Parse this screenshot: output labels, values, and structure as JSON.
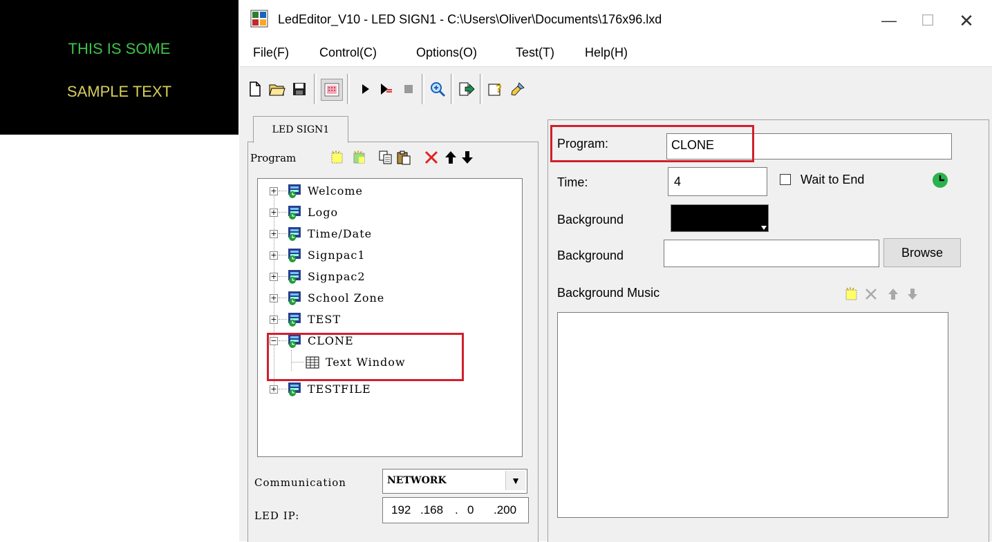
{
  "preview": {
    "line1": "THIS IS SOME",
    "line2": "SAMPLE TEXT"
  },
  "window": {
    "title": "LedEditor_V10 - LED SIGN1 - C:\\Users\\Oliver\\Documents\\176x96.lxd",
    "minimize_glyph": "—",
    "maximize_glyph": "☐",
    "close_glyph": "✕"
  },
  "menu": [
    "File(F)",
    "Control(C)",
    "Options(O)",
    "Test(T)",
    "Help(H)"
  ],
  "tab": {
    "label": "LED SIGN1"
  },
  "program_toolbar": {
    "label": "Program"
  },
  "tree": {
    "items": [
      {
        "label": "Welcome",
        "expander": "+"
      },
      {
        "label": "Logo",
        "expander": "+"
      },
      {
        "label": "Time/Date",
        "expander": "+"
      },
      {
        "label": "Signpac1",
        "expander": "+"
      },
      {
        "label": "Signpac2",
        "expander": "+"
      },
      {
        "label": "School Zone",
        "expander": "+"
      },
      {
        "label": "TEST",
        "expander": "+"
      },
      {
        "label": "CLONE",
        "expander": "−"
      },
      {
        "label": "Text Window",
        "child": true
      },
      {
        "label": "TESTFILE",
        "expander": "+"
      }
    ]
  },
  "communication": {
    "label": "Communication",
    "value": "NETWORK",
    "arrow": "▼"
  },
  "led_ip": {
    "label": "LED IP:",
    "octets": [
      "192",
      ".168",
      ".",
      "0",
      ".200"
    ]
  },
  "form": {
    "program_label": "Program:",
    "program_value": "CLONE",
    "time_label": "Time:",
    "time_value": "4",
    "wait_to_end_label": "Wait to End",
    "wait_to_end_checked": false,
    "background_color_label": "Background",
    "background_color": "#000000",
    "background_image_label": "Background",
    "background_image_value": "",
    "browse_label": "Browse",
    "music_label": "Background Music"
  },
  "colors": {
    "highlight": "#d11f2a",
    "clock_green": "#2bb24c",
    "led_green": "#3ec24a",
    "led_yellow": "#d6cf5a"
  }
}
